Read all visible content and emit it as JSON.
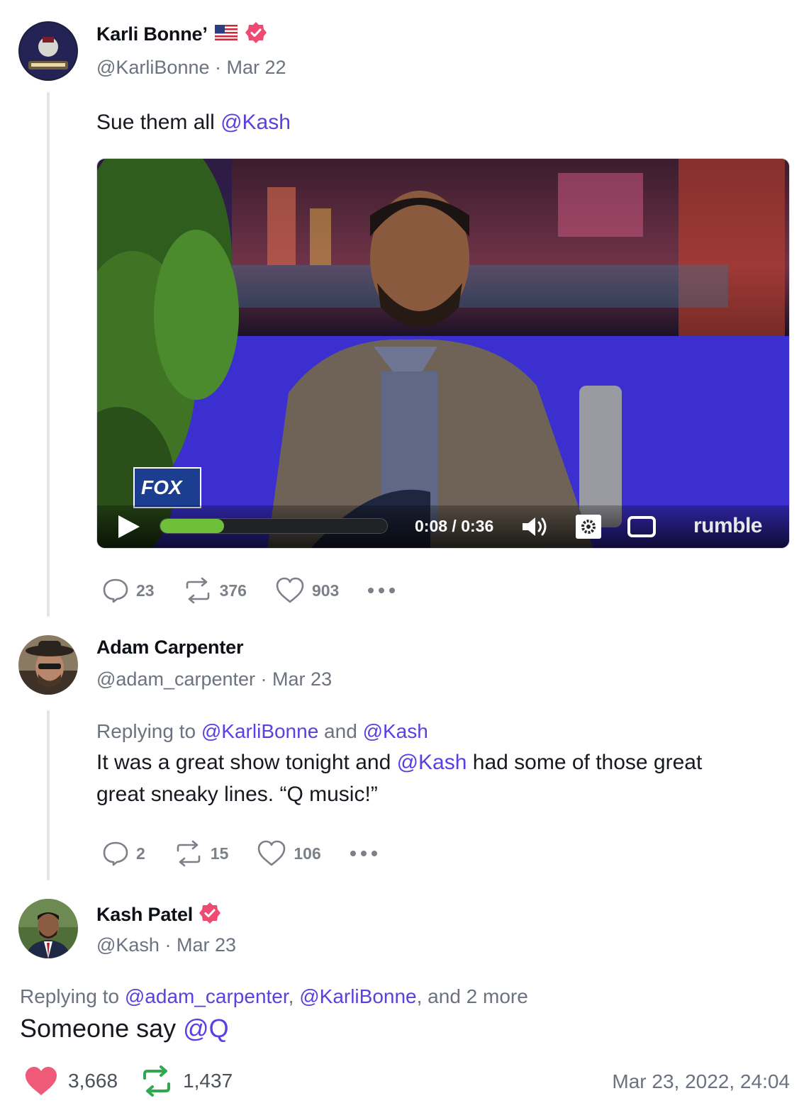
{
  "posts": [
    {
      "name": "Karli Bonne’",
      "handle": "@KarliBonne",
      "date": "Mar 22",
      "text": "Sue them all ",
      "mention": "@Kash",
      "video": {
        "time": "0:08 / 0:36",
        "progress": 0.28,
        "brand": "rumble",
        "network_logo": "FOX"
      },
      "stats": {
        "replies": "23",
        "reposts": "376",
        "likes": "903"
      }
    },
    {
      "name": "Adam Carpenter",
      "handle": "@adam_carpenter",
      "date": "Mar 23",
      "reply_prefix": "Replying to ",
      "reply_to_1": "@KarliBonne",
      "reply_and": " and ",
      "reply_to_2": "@Kash",
      "text_1": "It was a great show tonight and ",
      "mention": "@Kash",
      "text_2": " had some of those great",
      "text_3": "great sneaky lines. “Q music!”",
      "stats": {
        "replies": "2",
        "reposts": "15",
        "likes": "106"
      }
    },
    {
      "name": "Kash Patel",
      "handle": "@Kash",
      "date": "Mar 23",
      "reply_prefix": "Replying to ",
      "reply_to_1": "@adam_carpenter",
      "reply_sep": ", ",
      "reply_to_2": "@KarliBonne",
      "reply_more": ", and 2 more",
      "text": "Someone say ",
      "mention": "@Q",
      "stats": {
        "likes": "3,668",
        "reposts": "1,437"
      },
      "timestamp": "Mar 23, 2022, 24:04"
    }
  ],
  "colors": {
    "mention": "#5b3fe0",
    "verified": "#ee4b73",
    "like_active": "#f05a79",
    "repost_active": "#2fa84f",
    "progress": "#6fbf3a"
  }
}
